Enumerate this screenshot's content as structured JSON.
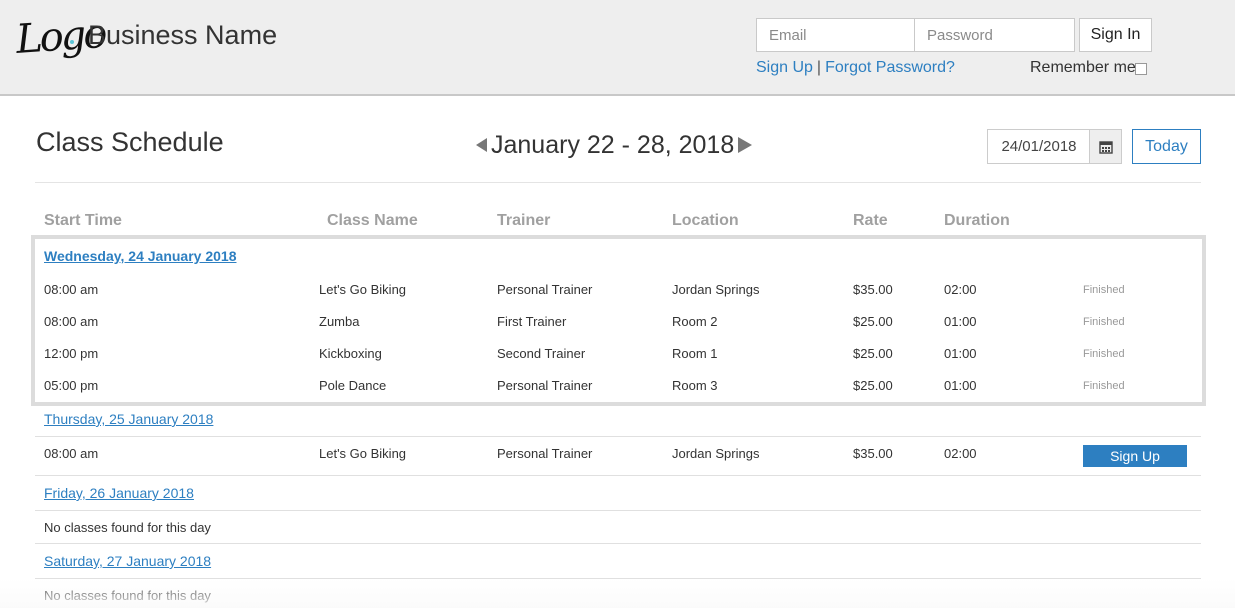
{
  "header": {
    "logo_text": "Logo",
    "business_name": "Business Name",
    "email_placeholder": "Email",
    "password_placeholder": "Password",
    "signin_label": "Sign In",
    "signup_link": "Sign Up",
    "separator": "|",
    "forgot_link": "Forgot Password?",
    "remember_label": "Remember me"
  },
  "schedule": {
    "title": "Class Schedule",
    "week_label": "January 22 - 28, 2018",
    "date_value": "24/01/2018",
    "today_label": "Today",
    "columns": [
      "Start Time",
      "Class Name",
      "Trainer",
      "Location",
      "Rate",
      "Duration"
    ],
    "days": [
      {
        "label": "Wednesday, 24 January 2018",
        "classes": [
          {
            "time": "08:00 am",
            "name": "Let's Go Biking",
            "trainer": "Personal Trainer",
            "location": "Jordan Springs",
            "rate": "$35.00",
            "duration": "02:00",
            "status": "Finished"
          },
          {
            "time": "08:00 am",
            "name": "Zumba",
            "trainer": "First Trainer",
            "location": "Room 2",
            "rate": "$25.00",
            "duration": "01:00",
            "status": "Finished"
          },
          {
            "time": "12:00 pm",
            "name": "Kickboxing",
            "trainer": "Second Trainer",
            "location": "Room 1",
            "rate": "$25.00",
            "duration": "01:00",
            "status": "Finished"
          },
          {
            "time": "05:00 pm",
            "name": "Pole Dance",
            "trainer": "Personal Trainer",
            "location": "Room 3",
            "rate": "$25.00",
            "duration": "01:00",
            "status": "Finished"
          }
        ]
      },
      {
        "label": "Thursday, 25 January 2018",
        "classes": [
          {
            "time": "08:00 am",
            "name": "Let's Go Biking",
            "trainer": "Personal Trainer",
            "location": "Jordan Springs",
            "rate": "$35.00",
            "duration": "02:00",
            "action": "Sign Up"
          }
        ]
      },
      {
        "label": "Friday, 26 January 2018",
        "empty_message": "No classes found for this day"
      },
      {
        "label": "Saturday, 27 January 2018",
        "empty_message": "No classes found for this day"
      }
    ]
  }
}
